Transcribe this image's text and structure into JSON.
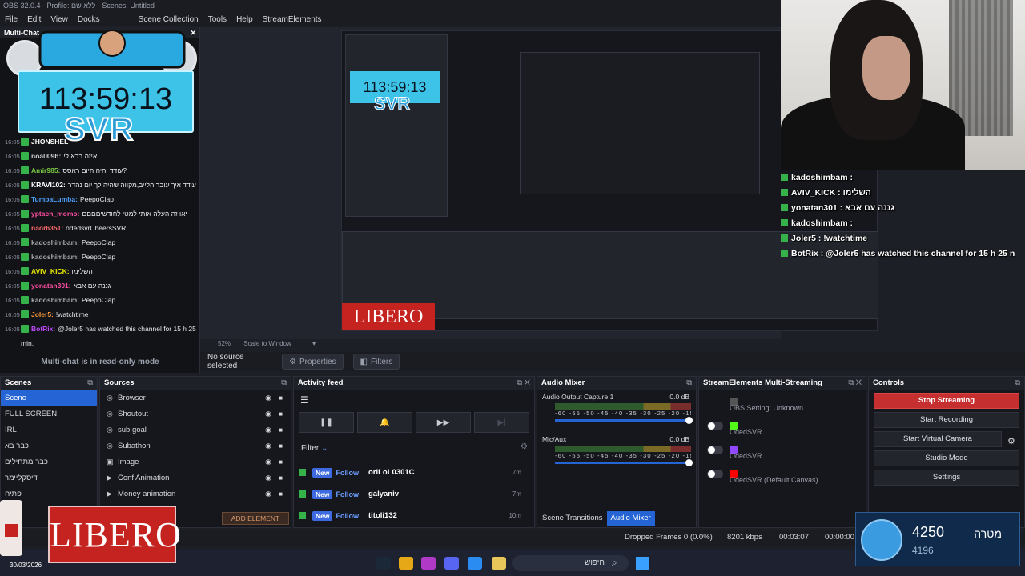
{
  "window": {
    "title": "OBS 32.0.4 - Profile: ללא שם - Scenes: Untitled"
  },
  "menu": [
    "File",
    "Edit",
    "View",
    "Docks",
    "",
    "Scene Collection",
    "Tools",
    "Help",
    "StreamElements"
  ],
  "chat": {
    "title": "Multi-Chat",
    "timer": "113:59:13",
    "brand": "SVR",
    "readonly": "Multi-chat is in read-only mode",
    "lines": [
      {
        "time": "16:05",
        "user": "JHONSHEL",
        "color": "#ffffff",
        "msg": ""
      },
      {
        "time": "16:05",
        "user": "noa009h:",
        "color": "#d2d2d2",
        "msg": "איזה בכא לי"
      },
      {
        "time": "16:05",
        "user": "Amir985:",
        "color": "#7ac943",
        "msg": "עודד יהיה היום ראסס?"
      },
      {
        "time": "16:05",
        "user": "KRAVI102:",
        "color": "#ffffff",
        "msg": "עודד איך עובר הלייב,מקווה שהיה לך יום נהדר"
      },
      {
        "time": "16:05",
        "user": "TumbaLumba:",
        "color": "#4ea1ff",
        "msg": "PeepoClap"
      },
      {
        "time": "16:05",
        "user": "yptach_momo:",
        "color": "#ff4fa3",
        "msg": "יאו זה העלה אותי למטי לחודשיםםםם"
      },
      {
        "time": "16:05",
        "user": "naor6351:",
        "color": "#ff6a6a",
        "msg": "odedsvrCheersSVR"
      },
      {
        "time": "16:05",
        "user": "kadoshimbam:",
        "color": "#a9a9a9",
        "msg": "PeepoClap"
      },
      {
        "time": "16:05",
        "user": "kadoshimbam:",
        "color": "#a9a9a9",
        "msg": "PeepoClap"
      },
      {
        "time": "16:05",
        "user": "AVIV_KICK:",
        "color": "#e6e600",
        "msg": "השלימו"
      },
      {
        "time": "16:05",
        "user": "yonatan301:",
        "color": "#ff4fa3",
        "msg": "גננה עם אבא"
      },
      {
        "time": "16:05",
        "user": "kadoshimbam:",
        "color": "#a9a9a9",
        "msg": "PeepoClap"
      },
      {
        "time": "16:05",
        "user": "Joler5:",
        "color": "#ff9a3c",
        "msg": "!watchtime"
      },
      {
        "time": "16:05",
        "user": "BotRix:",
        "color": "#c04bff",
        "msg": "@Joler5 has watched this channel for 15 h 25"
      }
    ],
    "wrap": "min."
  },
  "preview": {
    "zoom": "52%",
    "scale_mode": "Scale to Window",
    "no_source": "No source selected",
    "properties": "Properties",
    "filters": "Filters",
    "nested_timer": "113:59:13",
    "nested_brand": "SVR"
  },
  "overlay_chat": [
    {
      "user": "kadoshimbam :",
      "msg": ""
    },
    {
      "user": "AVIV_KICK :",
      "msg": "השלימו"
    },
    {
      "user": "yonatan301 :",
      "msg": "גננה עם אבא"
    },
    {
      "user": "kadoshimbam :",
      "msg": ""
    },
    {
      "user": "Joler5 :",
      "msg": "!watchtime"
    },
    {
      "user": "BotRix :",
      "msg": "@Joler5 has watched this channel for 15 h 25 n"
    }
  ],
  "scenes": {
    "title": "Scenes",
    "items": [
      "Scene",
      "FULL SCREEN",
      "IRL",
      "כבר בא",
      "כבר מתחילים",
      "דיסקליימר",
      "פתיח"
    ]
  },
  "sources": {
    "title": "Sources",
    "items": [
      {
        "icon": "browser-icon",
        "glyph": "◎",
        "label": "Browser"
      },
      {
        "icon": "browser-icon",
        "glyph": "◎",
        "label": "Shoutout"
      },
      {
        "icon": "browser-icon",
        "glyph": "◎",
        "label": "sub goal"
      },
      {
        "icon": "browser-icon",
        "glyph": "◎",
        "label": "Subathon"
      },
      {
        "icon": "image-icon",
        "glyph": "▣",
        "label": "Image"
      },
      {
        "icon": "play-icon",
        "glyph": "▶",
        "label": "Conf Animation"
      },
      {
        "icon": "play-icon",
        "glyph": "▶",
        "label": "Money animation"
      }
    ],
    "add_element": "ADD ELEMENT"
  },
  "activity": {
    "title": "Activity feed",
    "filter": "Filter",
    "items": [
      {
        "tag": "New",
        "type": "Follow",
        "name": "oriLoL0301C",
        "ago": "7m"
      },
      {
        "tag": "New",
        "type": "Follow",
        "name": "galyaniv",
        "ago": "7m"
      },
      {
        "tag": "New",
        "type": "Follow",
        "name": "titoli132",
        "ago": "10m"
      }
    ]
  },
  "mixer": {
    "title": "Audio Mixer",
    "scale": "-60 -55 -50 -45 -40 -35 -30 -25 -20 -15 -10 -5 0",
    "channels": [
      {
        "name": "Audio Output Capture 1",
        "db": "0.0 dB"
      },
      {
        "name": "Mic/Aux",
        "db": "0.0 dB"
      }
    ],
    "tab_transitions": "Scene Transitions",
    "tab_mixer": "Audio Mixer"
  },
  "multistream": {
    "title": "StreamElements Multi-Streaming",
    "rows": [
      {
        "platform_color": "#555555",
        "label": "OBS Setting: Unknown",
        "toggle": false
      },
      {
        "platform_color": "#53fc18",
        "label": "OdedSVR",
        "toggle": true
      },
      {
        "platform_color": "#9146ff",
        "label": "OdedSVR",
        "toggle": true
      },
      {
        "platform_color": "#ff0000",
        "label": "OdedSVR (Default Canvas)",
        "toggle": true
      }
    ]
  },
  "controls": {
    "title": "Controls",
    "stop_streaming": "Stop Streaming",
    "start_recording": "Start Recording",
    "start_virtual_camera": "Start Virtual Camera",
    "studio_mode": "Studio Mode",
    "settings": "Settings"
  },
  "status": {
    "dropped": "Dropped Frames 0 (0.0%)",
    "bitrate": "8201 kbps",
    "stream_time": "00:03:07",
    "rec_time": "00:00:00"
  },
  "overlay_bottom": {
    "brand": "LIBERO",
    "date": "30/03/2026",
    "goal_value": "4250",
    "goal_label": "מטרה",
    "goal_sub": "4196"
  },
  "taskbar": {
    "search": "חיפוש"
  }
}
